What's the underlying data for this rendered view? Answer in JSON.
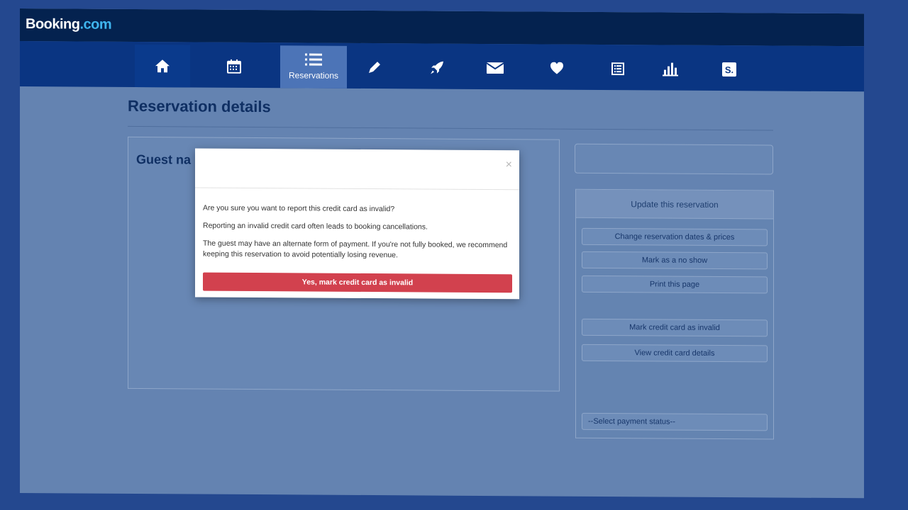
{
  "brand": {
    "name_main": "Booking",
    "name_suffix": ".com",
    "accent_color": "#3fb4ee"
  },
  "nav": {
    "items": [
      {
        "icon": "home-icon",
        "label": ""
      },
      {
        "icon": "calendar-icon",
        "label": ""
      },
      {
        "icon": "list-icon",
        "label": "Reservations",
        "active": true
      },
      {
        "icon": "pencil-icon",
        "label": ""
      },
      {
        "icon": "rocket-icon",
        "label": ""
      },
      {
        "icon": "envelope-icon",
        "label": ""
      },
      {
        "icon": "heart-icon",
        "label": ""
      },
      {
        "icon": "document-list-icon",
        "label": ""
      },
      {
        "icon": "bar-chart-icon",
        "label": ""
      },
      {
        "icon": "s-badge-icon",
        "label": "S."
      }
    ]
  },
  "page": {
    "title": "Reservation details",
    "guest_label": "Guest na"
  },
  "sidebar": {
    "header": "Update this reservation",
    "buttons": [
      "Change reservation dates & prices",
      "Mark as a no show",
      "Print this page",
      "Mark credit card as invalid",
      "View credit card details"
    ],
    "payment_select_value": "--Select payment status--"
  },
  "modal": {
    "close": "×",
    "question": "Are you sure you want to report this credit card as invalid?",
    "warning": "Reporting an invalid credit card often leads to booking cancellations.",
    "advice": "The guest may have an alternate form of payment. If you're not fully booked, we recommend keeping this reservation to avoid potentially losing revenue.",
    "confirm_label": "Yes, mark credit card as invalid",
    "confirm_color": "#d2414e"
  }
}
